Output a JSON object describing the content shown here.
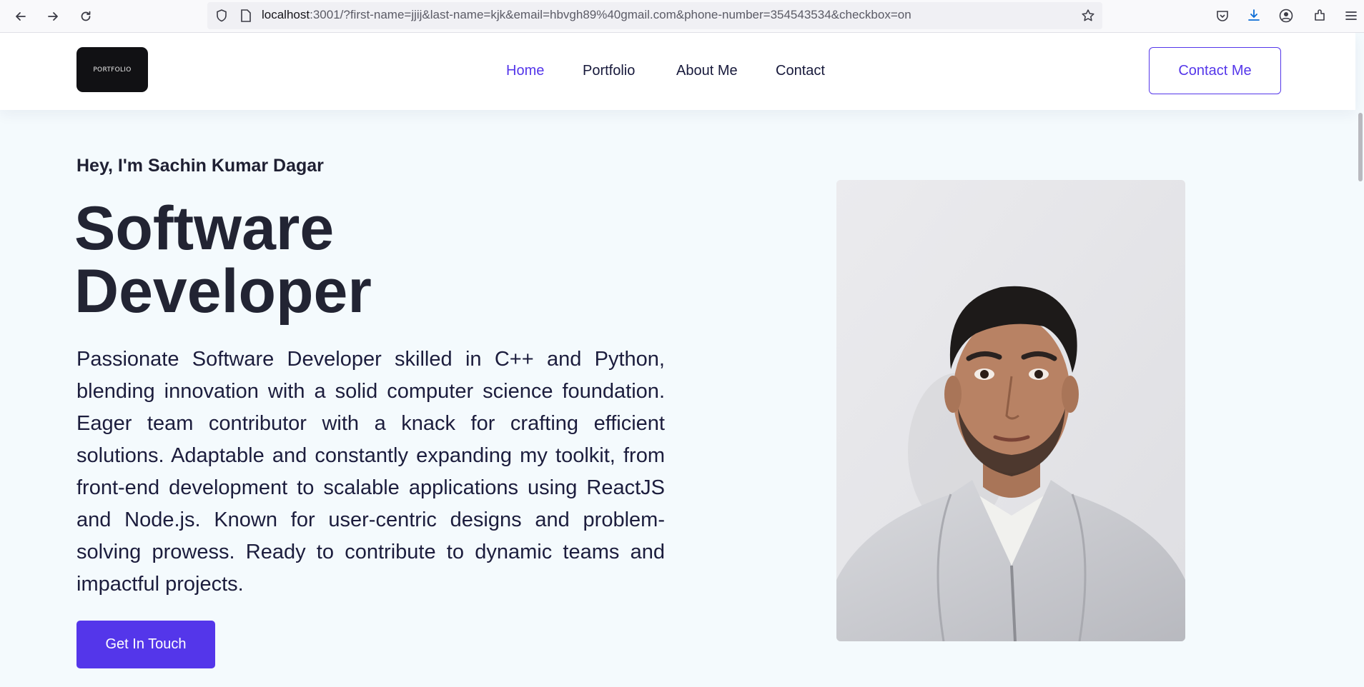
{
  "browser": {
    "url_host": "localhost",
    "url_rest": ":3001/?first-name=jjij&last-name=kjk&email=hbvgh89%40gmail.com&phone-number=354543534&checkbox=on"
  },
  "header": {
    "logo_text": "PORTFOLIO",
    "nav": [
      "Home",
      "Portfolio",
      "About Me",
      "Contact"
    ],
    "active_nav": "Home",
    "contact_button": "Contact Me"
  },
  "hero": {
    "greeting": "Hey, I'm Sachin Kumar Dagar",
    "title_line1": "Software",
    "title_line2": "Developer",
    "bio": "Passionate Software Developer skilled in C++ and Python, blending innovation with a solid computer science foundation. Eager team contributor with a knack for crafting efficient solutions. Adaptable and constantly expanding my toolkit, from front-end development to scalable applications using ReactJS and Node.js. Known for user-centric designs and problem-solving prowess. Ready to contribute to dynamic teams and impactful projects.",
    "cta_label": "Get In Touch"
  },
  "colors": {
    "accent": "#5436ea",
    "text_dark": "#222433",
    "page_bg": "#f4fafd"
  }
}
